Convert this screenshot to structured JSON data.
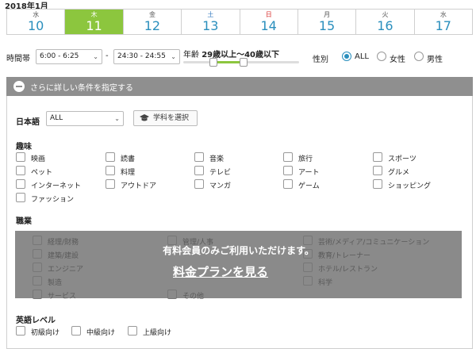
{
  "header": {
    "month": "2018年1月"
  },
  "dates": [
    {
      "dow": "水",
      "day": "10",
      "type": "normal"
    },
    {
      "dow": "木",
      "day": "11",
      "type": "active"
    },
    {
      "dow": "金",
      "day": "12",
      "type": "normal"
    },
    {
      "dow": "土",
      "day": "13",
      "type": "sat"
    },
    {
      "dow": "日",
      "day": "14",
      "type": "sun"
    },
    {
      "dow": "月",
      "day": "15",
      "type": "normal"
    },
    {
      "dow": "火",
      "day": "16",
      "type": "normal"
    },
    {
      "dow": "水",
      "day": "17",
      "type": "normal"
    }
  ],
  "filters": {
    "time_label": "時間帯",
    "time_from": "6:00 - 6:25",
    "time_to": "24:30 - 24:55",
    "time_sep": "-",
    "age_prefix": "年齢",
    "age_range": "29歳以上〜40歳以下",
    "age_min": 29,
    "age_max": 40,
    "gender_label": "性別",
    "gender_options": [
      "ALL",
      "女性",
      "男性"
    ],
    "gender_selected": "ALL"
  },
  "more_conditions": {
    "label": "さらに詳しい条件を指定する"
  },
  "japanese": {
    "label": "日本語",
    "selected": "ALL",
    "subject_button": "学科を選択"
  },
  "hobby": {
    "title": "趣味",
    "items": [
      "映画",
      "読書",
      "音楽",
      "旅行",
      "スポーツ",
      "ペット",
      "料理",
      "テレビ",
      "アート",
      "グルメ",
      "インターネット",
      "アウトドア",
      "マンガ",
      "ゲーム",
      "ショッピング",
      "ファッション"
    ]
  },
  "job": {
    "title": "職業",
    "items": [
      "経理/財務",
      "管理/人事",
      "芸術/メディア/コミュニケーション",
      "建築/建設",
      "教育/トレーナー",
      "エンジニア",
      "ホテル/レストラン",
      "製造",
      "科学",
      "サービス",
      "その他"
    ],
    "lock_message": "有料会員のみご利用いただけます。",
    "plan_link": "料金プランを見る"
  },
  "english": {
    "title": "英語レベル",
    "items": [
      "初級向け",
      "中級向け",
      "上級向け"
    ]
  },
  "colors": {
    "accent_green": "#8cc63e",
    "date_blue": "#2a8fbd",
    "bar_gray": "#8f8f8f"
  }
}
